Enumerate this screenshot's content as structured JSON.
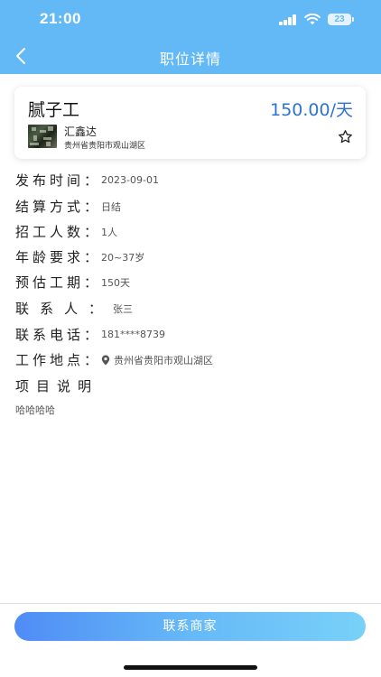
{
  "status_bar": {
    "time": "21:00",
    "battery": "23",
    "signal_icon": "cellular-signal-icon",
    "wifi_icon": "wifi-icon",
    "battery_icon": "battery-icon"
  },
  "nav": {
    "title": "职位详情",
    "back_icon": "chevron-left-icon"
  },
  "job": {
    "title": "腻子工",
    "wage": "150.00/天",
    "company": {
      "name": "汇鑫达",
      "address": "贵州省贵阳市观山湖区",
      "logo_icon": "company-logo-image"
    },
    "favorite_icon": "star-outline-icon"
  },
  "details": [
    {
      "key": "publish_time",
      "label": "发布时间：",
      "value": "2023-09-01",
      "spacing": 4
    },
    {
      "key": "settlement",
      "label": "结算方式：",
      "value": "日结",
      "spacing": 4
    },
    {
      "key": "headcount",
      "label": "招工人数：",
      "value": "1人",
      "spacing": 4
    },
    {
      "key": "age",
      "label": "年龄要求：",
      "value": "20~37岁",
      "spacing": 4
    },
    {
      "key": "period",
      "label": "预估工期：",
      "value": "150天",
      "spacing": 4
    },
    {
      "key": "contact",
      "label": "联系人：",
      "value": "张三",
      "spacing": 12
    },
    {
      "key": "phone",
      "label": "联系电话：",
      "value": "181****8739",
      "spacing": 4
    },
    {
      "key": "location",
      "label": "工作地点：",
      "value": "贵州省贵阳市观山湖区",
      "spacing": 4,
      "icon": "location-pin-icon"
    }
  ],
  "project": {
    "title": "项目说明",
    "description": "哈哈哈哈"
  },
  "actions": {
    "contact_button": "联系商家"
  },
  "colors": {
    "header": "#63b9f6",
    "wage": "#2d73d2",
    "button_start": "#4f8cf6",
    "button_end": "#78d1f8"
  }
}
